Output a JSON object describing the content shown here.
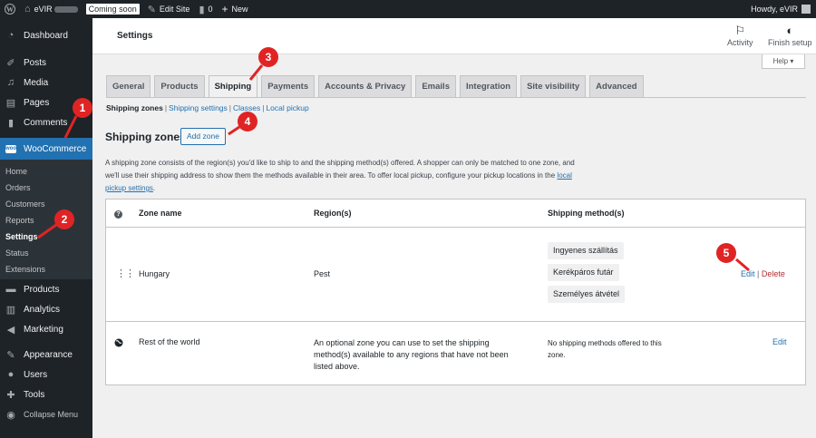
{
  "admin_bar": {
    "site_name": "eVIR",
    "coming_soon": "Coming soon",
    "edit_site": "Edit Site",
    "comments_count": "0",
    "new_label": "New",
    "howdy": "Howdy, eVIR"
  },
  "sidebar": {
    "dashboard": "Dashboard",
    "posts": "Posts",
    "media": "Media",
    "pages": "Pages",
    "comments": "Comments",
    "woocommerce": "WooCommerce",
    "submenu": [
      "Home",
      "Orders",
      "Customers",
      "Reports",
      "Settings",
      "Status",
      "Extensions"
    ],
    "products": "Products",
    "analytics": "Analytics",
    "marketing": "Marketing",
    "appearance": "Appearance",
    "users": "Users",
    "tools": "Tools",
    "collapse": "Collapse Menu"
  },
  "header": {
    "title": "Settings",
    "activity": "Activity",
    "finish_setup": "Finish setup",
    "help": "Help ▾"
  },
  "tabs": [
    "General",
    "Products",
    "Shipping",
    "Payments",
    "Accounts & Privacy",
    "Emails",
    "Integration",
    "Site visibility",
    "Advanced"
  ],
  "subnav": {
    "current": "Shipping zones",
    "settings": "Shipping settings",
    "classes": "Classes",
    "local_pickup": "Local pickup"
  },
  "zones": {
    "heading": "Shipping zones",
    "add_zone": "Add zone",
    "desc_text": "A shipping zone consists of the region(s) you'd like to ship to and the shipping method(s) offered. A shopper can only be matched to one zone, and we'll use their shipping address to show them the methods available in their area. To offer local pickup, configure your pickup locations in the",
    "desc_link": "local pickup settings",
    "desc_end": ".",
    "columns": {
      "name": "Zone name",
      "regions": "Region(s)",
      "methods": "Shipping method(s)"
    },
    "rows": [
      {
        "name": "Hungary",
        "region": "Pest",
        "methods": [
          "Ingyenes szállítás",
          "Kerékpáros futár",
          "Személyes átvétel"
        ],
        "edit": "Edit",
        "sep": "|",
        "delete": "Delete"
      },
      {
        "name": "Rest of the world",
        "region": "An optional zone you can use to set the shipping method(s) available to any regions that have not been listed above.",
        "no_methods": "No shipping methods offered to this zone.",
        "edit": "Edit"
      }
    ]
  },
  "annotations": [
    "1",
    "2",
    "3",
    "4",
    "5"
  ],
  "colors": {
    "accent": "#2271b1",
    "badge": "#e02424",
    "admin_bg": "#1d2327"
  }
}
